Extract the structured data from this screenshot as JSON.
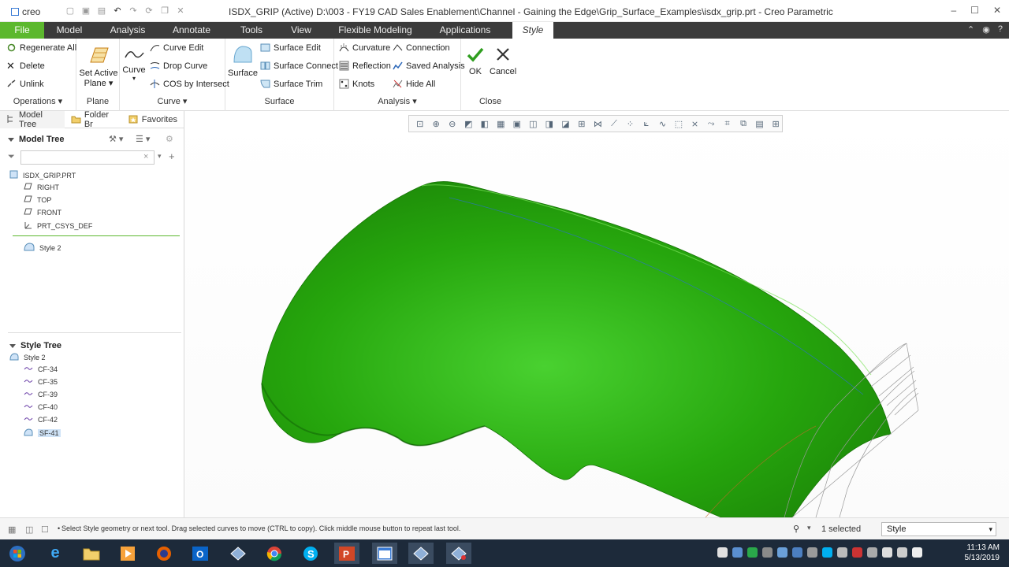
{
  "titlebar": {
    "app_name": "creo",
    "title": "ISDX_GRIP (Active) D:\\003 - FY19 CAD Sales Enablement\\Channel - Gaining the Edge\\Grip_Surface_Examples\\isdx_grip.prt - Creo Parametric"
  },
  "tabs": [
    "File",
    "Model",
    "Analysis",
    "Annotate",
    "Tools",
    "View",
    "Flexible Modeling",
    "Applications",
    "Style"
  ],
  "ribbon": {
    "operations": {
      "items": [
        "Regenerate All",
        "Delete",
        "Unlink"
      ],
      "group": "Operations"
    },
    "plane": {
      "label_line1": "Set Active",
      "label_line2": "Plane",
      "group": "Plane"
    },
    "curve": {
      "big": "Curve",
      "items": [
        "Curve Edit",
        "Drop Curve",
        "COS by Intersect"
      ],
      "group": "Curve"
    },
    "surface": {
      "big": "Surface",
      "items": [
        "Surface Edit",
        "Surface Connect",
        "Surface Trim"
      ],
      "group": "Surface"
    },
    "analysis": {
      "col1": [
        "Curvature",
        "Reflection",
        "Knots"
      ],
      "col2": [
        "Connection",
        "Saved Analysis",
        "Hide All"
      ],
      "group": "Analysis"
    },
    "close": {
      "ok": "OK",
      "cancel": "Cancel",
      "group": "Close"
    }
  },
  "leftpanel": {
    "tabs": [
      "Model Tree",
      "Folder Br",
      "Favorites"
    ],
    "model_tree_title": "Model Tree",
    "model_tree_items": [
      "ISDX_GRIP.PRT",
      "RIGHT",
      "TOP",
      "FRONT",
      "PRT_CSYS_DEF",
      "Style 2"
    ],
    "style_tree_title": "Style Tree",
    "style_tree_items": [
      "Style 2",
      "CF-34",
      "CF-35",
      "CF-39",
      "CF-40",
      "CF-42",
      "SF-41"
    ]
  },
  "statusbar": {
    "message": "Select Style geometry or next tool. Drag selected curves to move (CTRL to copy). Click middle mouse button to repeat last tool.",
    "selected": "1 selected",
    "mode": "Style"
  },
  "taskbar": {
    "time": "11:13 AM",
    "date": "5/13/2019"
  },
  "colors": {
    "accent_green": "#5cb82e",
    "surface_green": "#2aa80a",
    "tab_bar": "#3b3b3b",
    "taskbar": "#1d2a3a"
  }
}
